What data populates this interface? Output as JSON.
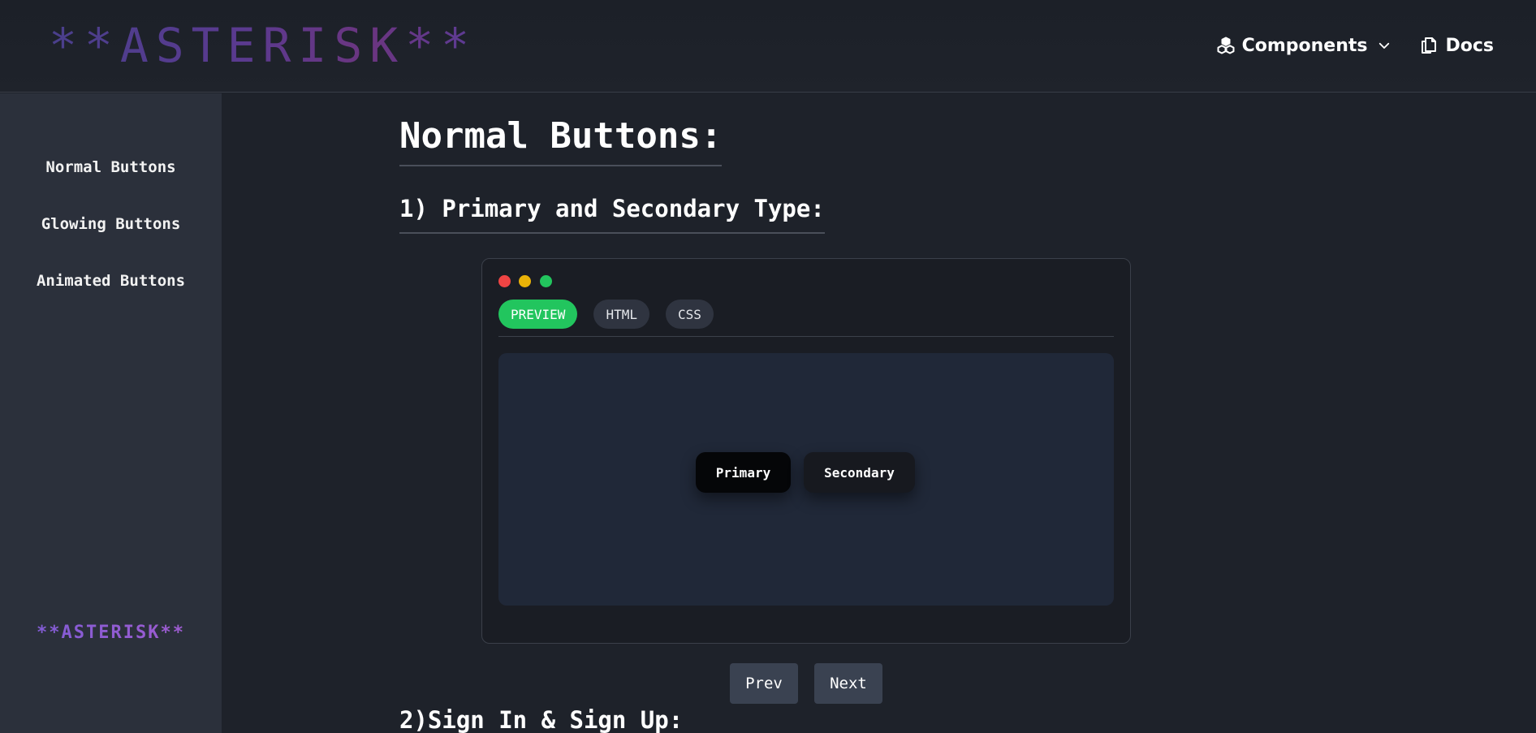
{
  "header": {
    "logo": "**ASTERISK**",
    "nav": {
      "components_label": "Components",
      "docs_label": "Docs"
    }
  },
  "sidebar": {
    "items": [
      {
        "label": "Normal Buttons"
      },
      {
        "label": "Glowing Buttons"
      },
      {
        "label": "Animated Buttons"
      }
    ],
    "brand": "**ASTERISK**"
  },
  "main": {
    "title": "Normal Buttons:",
    "section1_title": "1) Primary and Secondary Type:",
    "window": {
      "tabs": [
        {
          "label": "PREVIEW",
          "active": true
        },
        {
          "label": "HTML",
          "active": false
        },
        {
          "label": "CSS",
          "active": false
        }
      ],
      "preview_buttons": {
        "primary": "Primary",
        "secondary": "Secondary"
      }
    },
    "pager": {
      "prev": "Prev",
      "next": "Next"
    },
    "section2_title": "2)Sign In & Sign Up:"
  },
  "colors": {
    "active_tab": "#22c55e",
    "dot_red": "#ef4444",
    "dot_yellow": "#eab308",
    "dot_green": "#22c55e"
  },
  "icons": {
    "components": "cubes-icon",
    "components_chevron": "chevron-down-icon",
    "docs": "documents-icon"
  }
}
